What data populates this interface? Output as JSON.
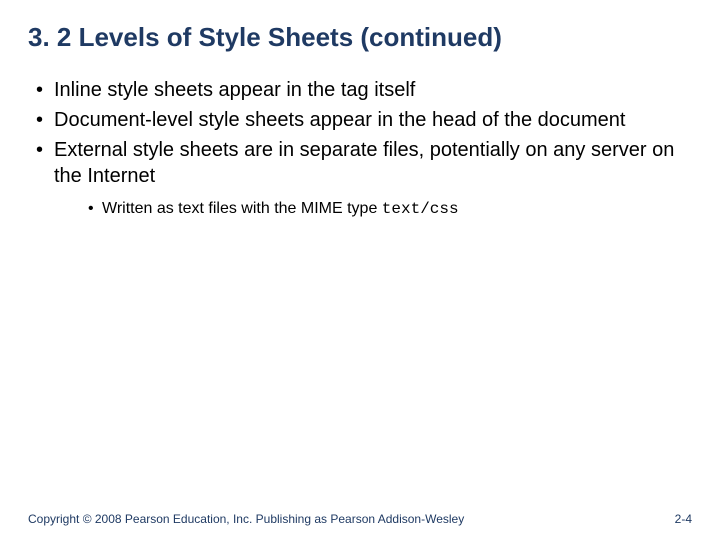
{
  "title": "3. 2 Levels of Style Sheets (continued)",
  "bullets": [
    {
      "text": "Inline style sheets appear in the tag itself"
    },
    {
      "text": "Document-level style sheets appear in the head of the document"
    },
    {
      "text": "External style sheets are in separate files, potentially on any server on the Internet"
    }
  ],
  "subbullet_prefix": "Written as text files with the MIME type ",
  "subbullet_code": "text/css",
  "footer": {
    "copyright": "Copyright © 2008 Pearson Education, Inc. Publishing as Pearson Addison-Wesley",
    "page": "2-4"
  }
}
